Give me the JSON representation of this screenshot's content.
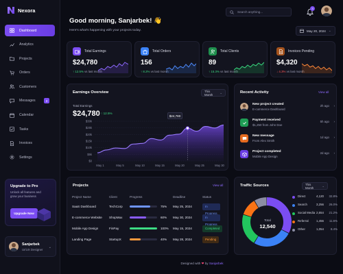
{
  "app": {
    "name": "Nexora"
  },
  "sidebar": {
    "items": [
      {
        "label": "Dashboard",
        "icon": "grid-icon"
      },
      {
        "label": "Analytics",
        "icon": "chart-icon"
      },
      {
        "label": "Projects",
        "icon": "folder-icon"
      },
      {
        "label": "Orders",
        "icon": "cart-icon"
      },
      {
        "label": "Customers",
        "icon": "users-icon"
      },
      {
        "label": "Messages",
        "icon": "message-icon",
        "badge": "3"
      },
      {
        "label": "Calendar",
        "icon": "calendar-icon"
      },
      {
        "label": "Tasks",
        "icon": "checkbox-icon"
      },
      {
        "label": "Invoices",
        "icon": "document-icon"
      },
      {
        "label": "Settings",
        "icon": "gear-icon"
      }
    ],
    "upgrade": {
      "title": "Upgrade to Pro",
      "text": "Unlock all features and grow your business",
      "button": "Upgrade Now"
    },
    "user": {
      "name": "Sanjarbek",
      "role": "UI/UX Designer"
    }
  },
  "header": {
    "greeting": "Good morning, Sanjarbek! 👋",
    "subtitle": "Here's what's happening with your projects today.",
    "search_placeholder": "Search anything...",
    "notifications": "3",
    "date": "May 20, 2024"
  },
  "stats": [
    {
      "label": "Total Earnings",
      "value": "$24,780",
      "delta": "↑ 12.5%",
      "note": "vs last month",
      "trend": "up",
      "color": "#7b4df2",
      "icon": "wallet-icon"
    },
    {
      "label": "Total Orders",
      "value": "156",
      "delta": "↑ 8.2%",
      "note": "vs last month",
      "trend": "up",
      "color": "#3b82f6",
      "icon": "bag-icon"
    },
    {
      "label": "Total Clients",
      "value": "89",
      "delta": "↑ 15.3%",
      "note": "vs last month",
      "trend": "up",
      "color": "#22c55e",
      "icon": "users-icon"
    },
    {
      "label": "Invoices Pending",
      "value": "$4,320",
      "delta": "↓ 4.3%",
      "note": "vs last month",
      "trend": "down",
      "color": "#f97316",
      "icon": "document-icon"
    }
  ],
  "earnings": {
    "title": "Earnings Overview",
    "period": "This Month",
    "sub_label": "Total Earnings",
    "value": "$24,780",
    "delta": "↑ 12.5%",
    "tooltip": "$24,780"
  },
  "chart_data": {
    "type": "area",
    "x": [
      "May 1",
      "May 3",
      "May 5",
      "May 7",
      "May 9",
      "May 11",
      "May 13",
      "May 15",
      "May 17",
      "May 19",
      "May 20",
      "May 22",
      "May 25",
      "May 27",
      "May 30"
    ],
    "tick_labels_x": [
      "May 1",
      "May 5",
      "May 10",
      "May 15",
      "May 20",
      "May 25",
      "May 30"
    ],
    "tick_labels_y": [
      "$0",
      "$5k",
      "$10k",
      "$15k",
      "$20k",
      "$25k",
      "$30k"
    ],
    "values": [
      6200,
      8300,
      9800,
      9400,
      12800,
      13300,
      16900,
      15800,
      19500,
      20200,
      24780,
      22500,
      26100,
      24900,
      27200
    ],
    "ylim": [
      0,
      30000
    ],
    "highlight_index": 10,
    "color": "#7b4df2"
  },
  "activity": {
    "title": "Recent Activity",
    "view_all": "View all",
    "items": [
      {
        "title": "New project created",
        "sub": "E-commerce Dashboard",
        "time": "2h ago",
        "icon": "avatar-icon",
        "color": "#c9a88a"
      },
      {
        "title": "Payment received",
        "sub": "$1,250 from John Doe",
        "time": "5h ago",
        "icon": "check-icon",
        "color": "#22c55e"
      },
      {
        "title": "New message",
        "sub": "From Alex Smith",
        "time": "1d ago",
        "icon": "message-icon",
        "color": "#f97316"
      },
      {
        "title": "Project completed",
        "sub": "Mobile App Design",
        "time": "2d ago",
        "icon": "cube-icon",
        "color": "#7b4df2"
      }
    ]
  },
  "projects": {
    "title": "Projects",
    "view_all": "View all",
    "columns": [
      "Project Name",
      "Client",
      "Progress",
      "Deadline",
      "Status"
    ],
    "rows": [
      {
        "name": "SaaS Dashboard",
        "client": "TechCorp",
        "progress": 75,
        "progress_label": "75%",
        "deadline": "May 25, 2024",
        "status": "In Progress",
        "color": "#6f95ff"
      },
      {
        "name": "E-commerce Website",
        "client": "ShopMax",
        "progress": 60,
        "progress_label": "60%",
        "deadline": "May 30, 2024",
        "status": "In Progress",
        "color": "#8a5cff"
      },
      {
        "name": "Mobile App Design",
        "client": "FinPay",
        "progress": 100,
        "progress_label": "100%",
        "deadline": "May 15, 2024",
        "status": "Completed",
        "color": "#3ddc84"
      },
      {
        "name": "Landing Page",
        "client": "StartupX",
        "progress": 40,
        "progress_label": "40%",
        "deadline": "May 28, 2024",
        "status": "Pending",
        "color": "#ff9a3d"
      }
    ]
  },
  "traffic": {
    "title": "Traffic Sources",
    "period": "This Month",
    "center_label": "Total",
    "center_value": "12,540",
    "sources": [
      {
        "name": "Direct",
        "value": "4,120",
        "pct": "32.8%",
        "share": 32.8,
        "color": "#7b4df2"
      },
      {
        "name": "Search",
        "value": "3,256",
        "pct": "26.0%",
        "share": 26.0,
        "color": "#3b82f6"
      },
      {
        "name": "Social Media",
        "value": "2,654",
        "pct": "21.2%",
        "share": 21.2,
        "color": "#22c55e"
      },
      {
        "name": "Referral",
        "value": "1,456",
        "pct": "11.6%",
        "share": 11.6,
        "color": "#f97316"
      },
      {
        "name": "Other",
        "value": "1,054",
        "pct": "8.4%",
        "share": 8.4,
        "color": "#8b8da3"
      }
    ]
  },
  "footer": {
    "text": "Designed with",
    "heart": "❤",
    "by": "by",
    "author": "Sanjarbek"
  }
}
